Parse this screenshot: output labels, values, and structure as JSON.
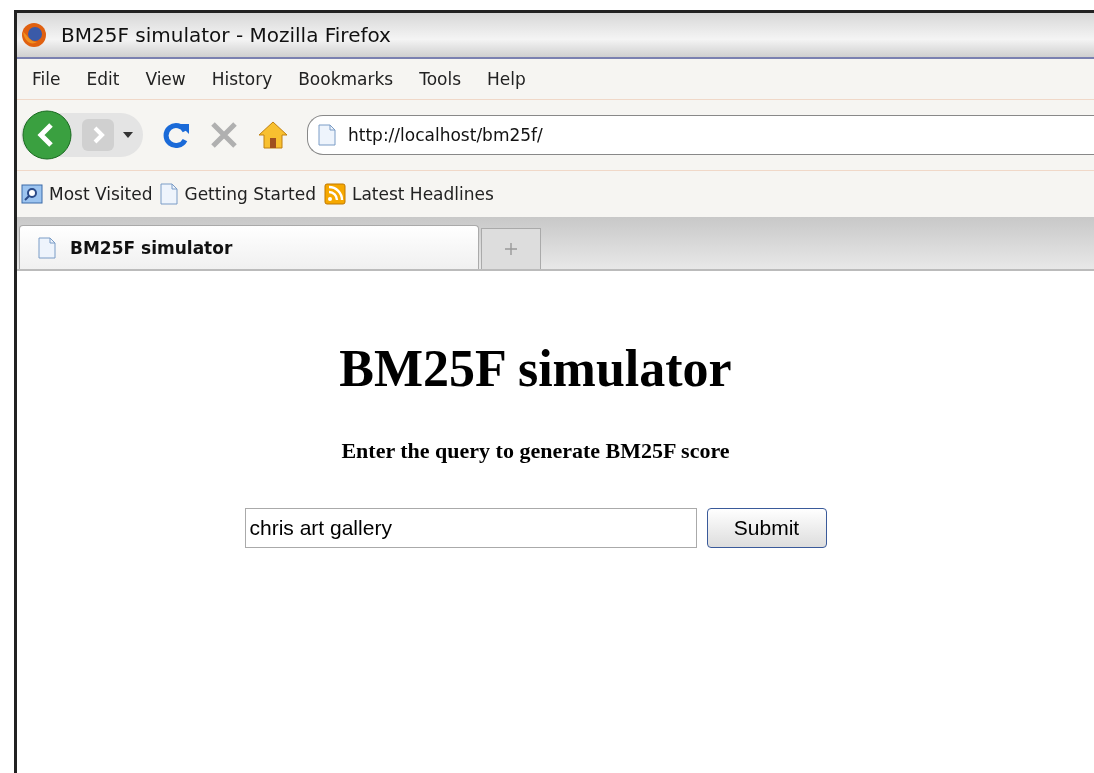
{
  "window": {
    "title": "BM25F simulator - Mozilla Firefox"
  },
  "menu": [
    "File",
    "Edit",
    "View",
    "History",
    "Bookmarks",
    "Tools",
    "Help"
  ],
  "address_bar": {
    "value": "http://localhost/bm25f/"
  },
  "bookmarks": [
    {
      "kind": "folder",
      "label": "Most Visited"
    },
    {
      "kind": "page",
      "label": "Getting Started"
    },
    {
      "kind": "feed",
      "label": "Latest Headlines"
    }
  ],
  "tabs": [
    {
      "label": "BM25F simulator",
      "selected": true
    }
  ],
  "page": {
    "heading": "BM25F simulator",
    "subheading": "Enter the query to generate BM25F score",
    "query": {
      "value": "chris art gallery"
    },
    "submit": "Submit"
  }
}
